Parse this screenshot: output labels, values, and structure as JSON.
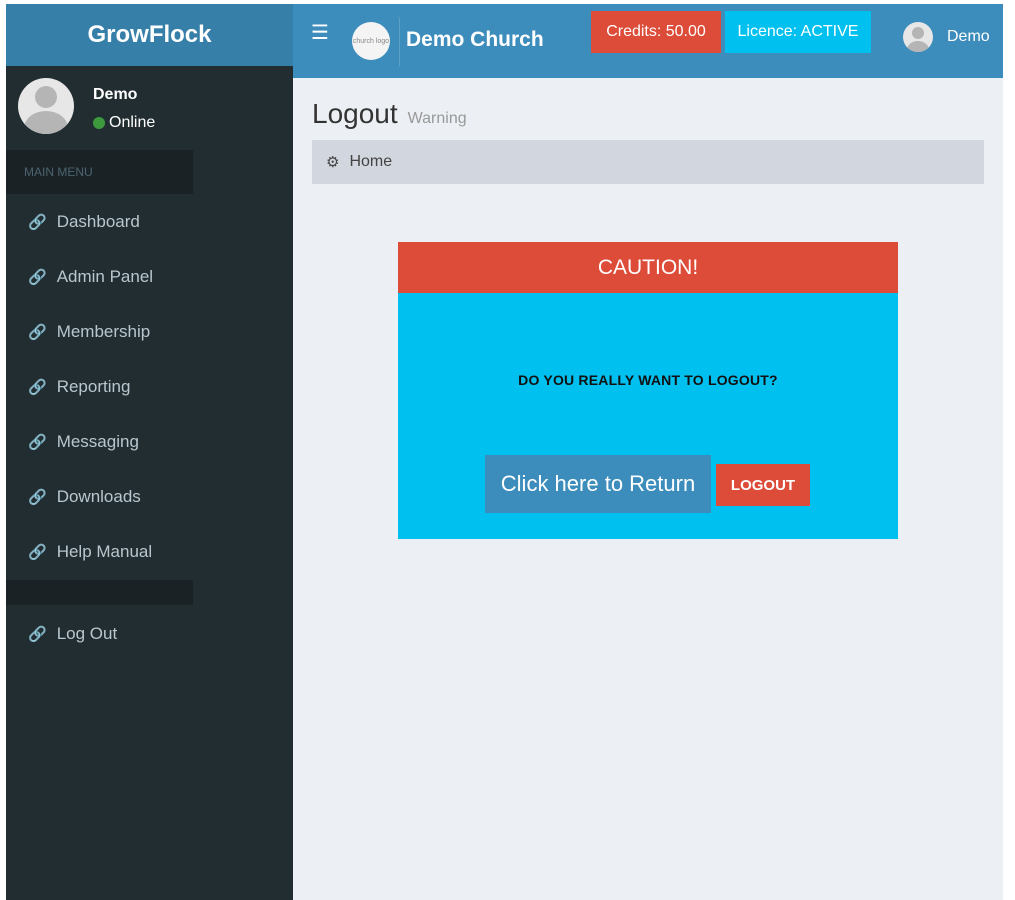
{
  "app": {
    "brand": "GrowFlock"
  },
  "header": {
    "church_logo_text": "church logo",
    "church_name": "Demo Church",
    "credits": "Credits: 50.00",
    "licence": "Licence: ACTIVE",
    "user": "Demo"
  },
  "sidebar": {
    "user_name": "Demo",
    "status": "Online",
    "menu_header": "MAIN MENU",
    "items": [
      {
        "label": "Dashboard",
        "icon": "link-icon"
      },
      {
        "label": "Admin Panel",
        "icon": "link-icon"
      },
      {
        "label": "Membership",
        "icon": "link-icon"
      },
      {
        "label": "Reporting",
        "icon": "link-icon"
      },
      {
        "label": "Messaging",
        "icon": "link-icon"
      },
      {
        "label": "Downloads",
        "icon": "link-icon"
      },
      {
        "label": "Help Manual",
        "icon": "link-icon"
      }
    ],
    "logout": {
      "label": "Log Out",
      "icon": "link-icon"
    }
  },
  "content": {
    "title": "Logout",
    "subtitle": "Warning",
    "breadcrumb": "Home",
    "caution": {
      "header": "CAUTION!",
      "message": "DO YOU REALLY WANT TO LOGOUT?",
      "return_button": "Click here to Return",
      "logout_button": "LOGOUT"
    }
  },
  "colors": {
    "header_blue": "#3c8dbc",
    "brand_blue": "#367fa9",
    "sidebar_dark": "#222d32",
    "danger_red": "#dd4b39",
    "info_cyan": "#00c0ef",
    "online_green": "#3c9a3c"
  }
}
